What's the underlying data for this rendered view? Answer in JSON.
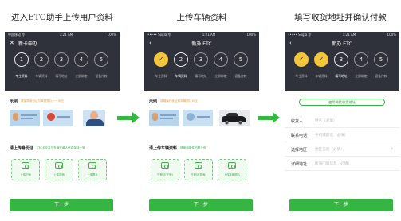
{
  "captions": [
    "进入ETC助手上传用户资料",
    "上传车辆资料",
    "填写收货地址并确认付款"
  ],
  "colors": {
    "accent_green": "#36b542",
    "header_dark": "#2f323a",
    "step_done": "#f3c53a",
    "warning_orange": "#f0a030"
  },
  "screens": [
    {
      "status_left": "中国移动 令",
      "status_time": "1:21 AM",
      "status_right": "100%",
      "nav_icon": "close-icon",
      "title": "新卡申办",
      "steps": [
        "1",
        "2",
        "3",
        "4",
        "5"
      ],
      "step_labels": [
        "专主资料",
        "车辆资料",
        "填写地址",
        "立即绑定",
        "设备付款"
      ],
      "example_label": "示例",
      "example_hint": "请保障身份证与驾照照片一一对应",
      "upload_label": "请上传身份证",
      "upload_hint": "ETC卡实名与车辆开单人信息保持一致",
      "upload_tiles": [
        "上传正面",
        "上传背面",
        "上传照片"
      ],
      "next_label": "下一步"
    },
    {
      "status_left": "••••• Sogla 令",
      "status_time": "1:21 AM",
      "status_right": "100%",
      "nav_icon": "back-icon",
      "title": "新办 ETC",
      "steps": [
        "✓",
        "2",
        "3",
        "4",
        "5"
      ],
      "step_labels": [
        "车主资料",
        "车辆资料",
        "填写地址",
        "立即绑定",
        "设备付款"
      ],
      "example_label": "示例",
      "example_hint": "请确保行驶证和车辆照片对应",
      "upload_label": "请上传车辆资料",
      "upload_hint": "请使用原件拍照上传",
      "upload_tiles": [
        "行驶证(正面)",
        "行驶证(背面)",
        "上传车辆照片"
      ],
      "next_label": "下一步"
    },
    {
      "status_left": "••••• Sogla 令",
      "status_time": "1:21 AM",
      "status_right": "100%",
      "nav_icon": "back-icon",
      "title": "新办 ETC",
      "steps": [
        "✓",
        "✓",
        "3",
        "4",
        "5"
      ],
      "step_labels": [
        "车主资料",
        "车辆资料",
        "填写地址",
        "立即绑定",
        "设备付款"
      ],
      "address_button": "使用微信收货地址",
      "fields": [
        {
          "label": "收货人",
          "placeholder": "姓名（必填）",
          "chevron": ""
        },
        {
          "label": "联系电话",
          "placeholder": "手机或座话（必填）",
          "chevron": ""
        },
        {
          "label": "选择地区",
          "placeholder": "地区信息（必填）",
          "chevron": "›"
        },
        {
          "label": "详细地址",
          "placeholder": "街道门牌信息（必填）",
          "chevron": ""
        }
      ],
      "next_label": "下一步"
    }
  ]
}
